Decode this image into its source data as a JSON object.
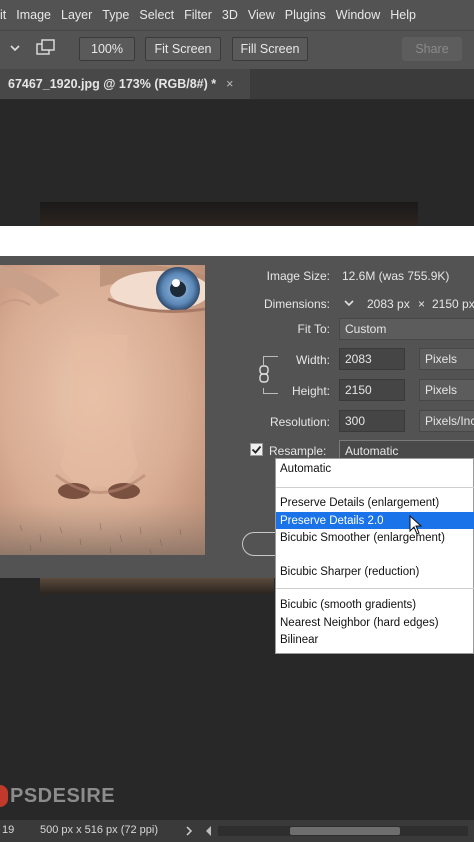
{
  "menubar": {
    "items": [
      "it",
      "Image",
      "Layer",
      "Type",
      "Select",
      "Filter",
      "3D",
      "View",
      "Plugins",
      "Window",
      "Help"
    ]
  },
  "options_bar": {
    "zoom_label": "100%",
    "fit_screen_label": "Fit Screen",
    "fill_screen_label": "Fill Screen",
    "share_label": "Share"
  },
  "document_tab": {
    "title": "67467_1920.jpg @ 173% (RGB/8#) *",
    "close_glyph": "×"
  },
  "image_size_dialog": {
    "image_size_label": "Image Size:",
    "image_size_value": "12.6M (was 755.9K)",
    "dimensions_label": "Dimensions:",
    "dimensions_width": "2083 px",
    "dimensions_times": "×",
    "dimensions_height": "2150 px",
    "fit_to_label": "Fit To:",
    "fit_to_value": "Custom",
    "width_label": "Width:",
    "width_value": "2083",
    "width_unit": "Pixels",
    "height_label": "Height:",
    "height_value": "2150",
    "height_unit": "Pixels",
    "resolution_label": "Resolution:",
    "resolution_value": "300",
    "resolution_unit": "Pixels/Inc",
    "resample_label": "Resample:",
    "resample_checked": true,
    "resample_value": "Automatic"
  },
  "resample_dropdown": {
    "items": [
      "Automatic",
      "Preserve Details (enlargement)",
      "Preserve Details 2.0",
      "Bicubic Smoother (enlargement)",
      "Bicubic Sharper (reduction)",
      "Bicubic (smooth gradients)",
      "Nearest Neighbor (hard edges)",
      "Bilinear"
    ],
    "highlighted_index": 2
  },
  "watermark": {
    "text": "PSDESIRE"
  },
  "status_bar": {
    "zoom_fragment": "19",
    "doc_info": "500 px x 516 px (72 ppi)"
  },
  "colors": {
    "menu_bg": "#535353",
    "workspace_bg": "#282828",
    "highlight": "#1a73e8"
  }
}
